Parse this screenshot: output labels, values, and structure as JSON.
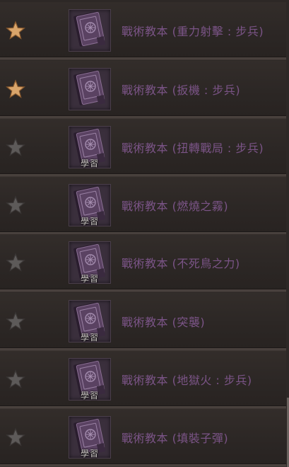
{
  "items": [
    {
      "title": "戰術教本 (重力射擊 : 步兵)",
      "starred": true,
      "learn_label": ""
    },
    {
      "title": "戰術教本 (扳機 : 步兵)",
      "starred": true,
      "learn_label": ""
    },
    {
      "title": "戰術教本 (扭轉戰局 : 步兵)",
      "starred": false,
      "learn_label": "學習"
    },
    {
      "title": "戰術教本 (燃燒之霧)",
      "starred": false,
      "learn_label": "學習"
    },
    {
      "title": "戰術教本 (不死鳥之力)",
      "starred": false,
      "learn_label": "學習"
    },
    {
      "title": "戰術教本 (突襲)",
      "starred": false,
      "learn_label": "學習"
    },
    {
      "title": "戰術教本 (地獄火 : 步兵)",
      "starred": false,
      "learn_label": "學習"
    },
    {
      "title": "戰術教本 (填裝子彈)",
      "starred": false,
      "learn_label": "學習"
    }
  ],
  "colors": {
    "star_active": "#d9a56b",
    "star_inactive": "#5d5a59",
    "title_text": "#7b5487",
    "book": "#4a3552"
  },
  "icons": {
    "star": "star-icon",
    "book": "tactics-book-icon"
  }
}
